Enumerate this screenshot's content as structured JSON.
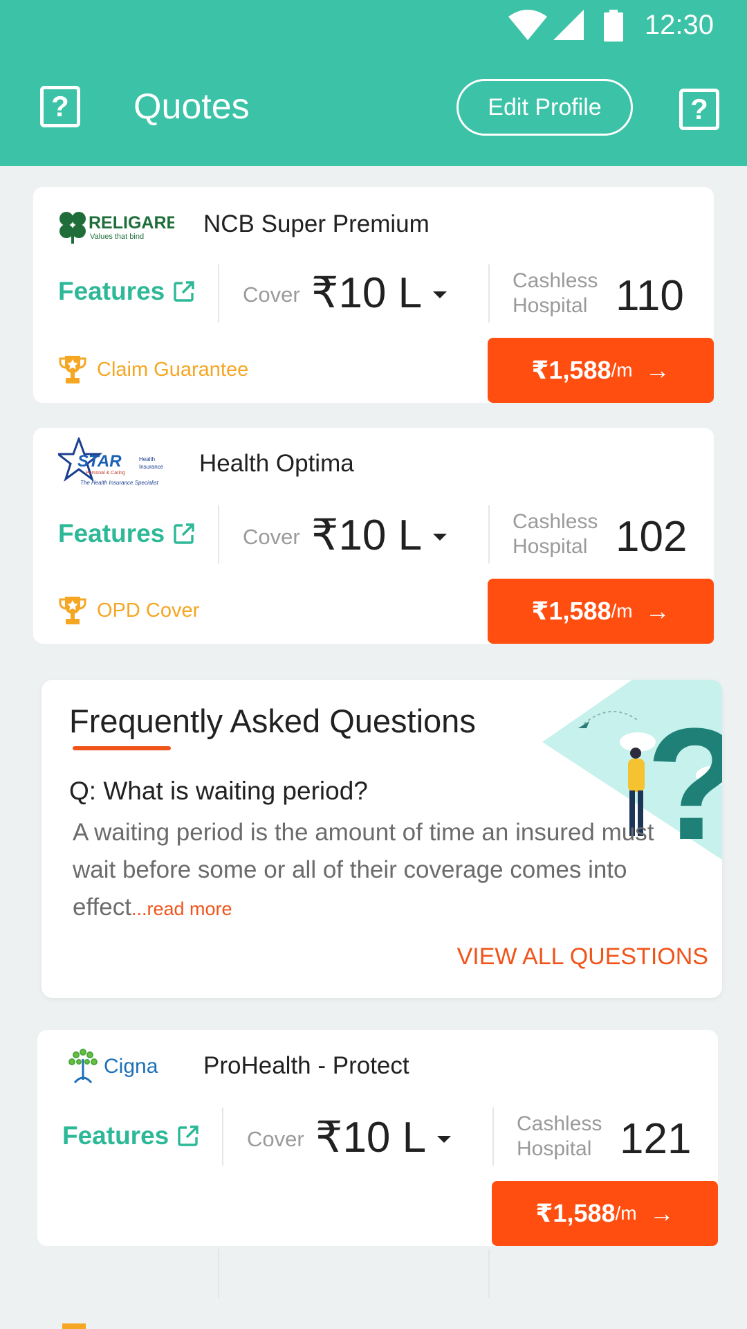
{
  "status_bar": {
    "time": "12:30"
  },
  "header": {
    "title": "Quotes",
    "edit_profile_label": "Edit Profile",
    "help_glyph": "?"
  },
  "quotes": [
    {
      "insurer": "RELIGARE",
      "insurer_tagline": "Values that bind",
      "plan": "NCB Super Premium",
      "features_label": "Features",
      "cover_label": "Cover",
      "cover_value": "₹10 L",
      "cashless_label_1": "Cashless",
      "cashless_label_2": "Hospital",
      "hospital_count": "110",
      "tag": "Claim Guarantee",
      "price": "₹1,588",
      "price_unit": "/m"
    },
    {
      "insurer": "STAR",
      "insurer_sub_1": "Health",
      "insurer_sub_2": "Insurance",
      "insurer_tag_1": "Personal & Caring",
      "insurer_tagline": "The Health Insurance Specialist",
      "plan": "Health Optima",
      "features_label": "Features",
      "cover_label": "Cover",
      "cover_value": "₹10 L",
      "cashless_label_1": "Cashless",
      "cashless_label_2": "Hospital",
      "hospital_count": "102",
      "tag": "OPD Cover",
      "price": "₹1,588",
      "price_unit": "/m"
    },
    {
      "insurer": "Cigna",
      "plan": "ProHealth - Protect",
      "features_label": "Features",
      "cover_label": "Cover",
      "cover_value": "₹10 L",
      "cashless_label_1": "Cashless",
      "cashless_label_2": "Hospital",
      "hospital_count": "121",
      "price": "₹1,588",
      "price_unit": "/m"
    }
  ],
  "faq": {
    "title": "Frequently Asked Questions",
    "question": "Q: What is waiting period?",
    "answer": "A waiting period is the amount of time an insured must wait before some or all of their coverage comes into effect",
    "ellipsis": "...",
    "read_more": "read more",
    "view_all": "VIEW ALL QUESTIONS"
  },
  "colors": {
    "header": "#3bc2a7",
    "features": "#2db897",
    "price_button": "#ff4e0f",
    "tag": "#f5a623",
    "faq_accent": "#f0541a"
  },
  "icons": {
    "help": "help-icon",
    "external_link": "external-link-icon",
    "trophy": "trophy-icon",
    "arrow": "arrow-right-icon",
    "caret": "chevron-down-icon"
  }
}
